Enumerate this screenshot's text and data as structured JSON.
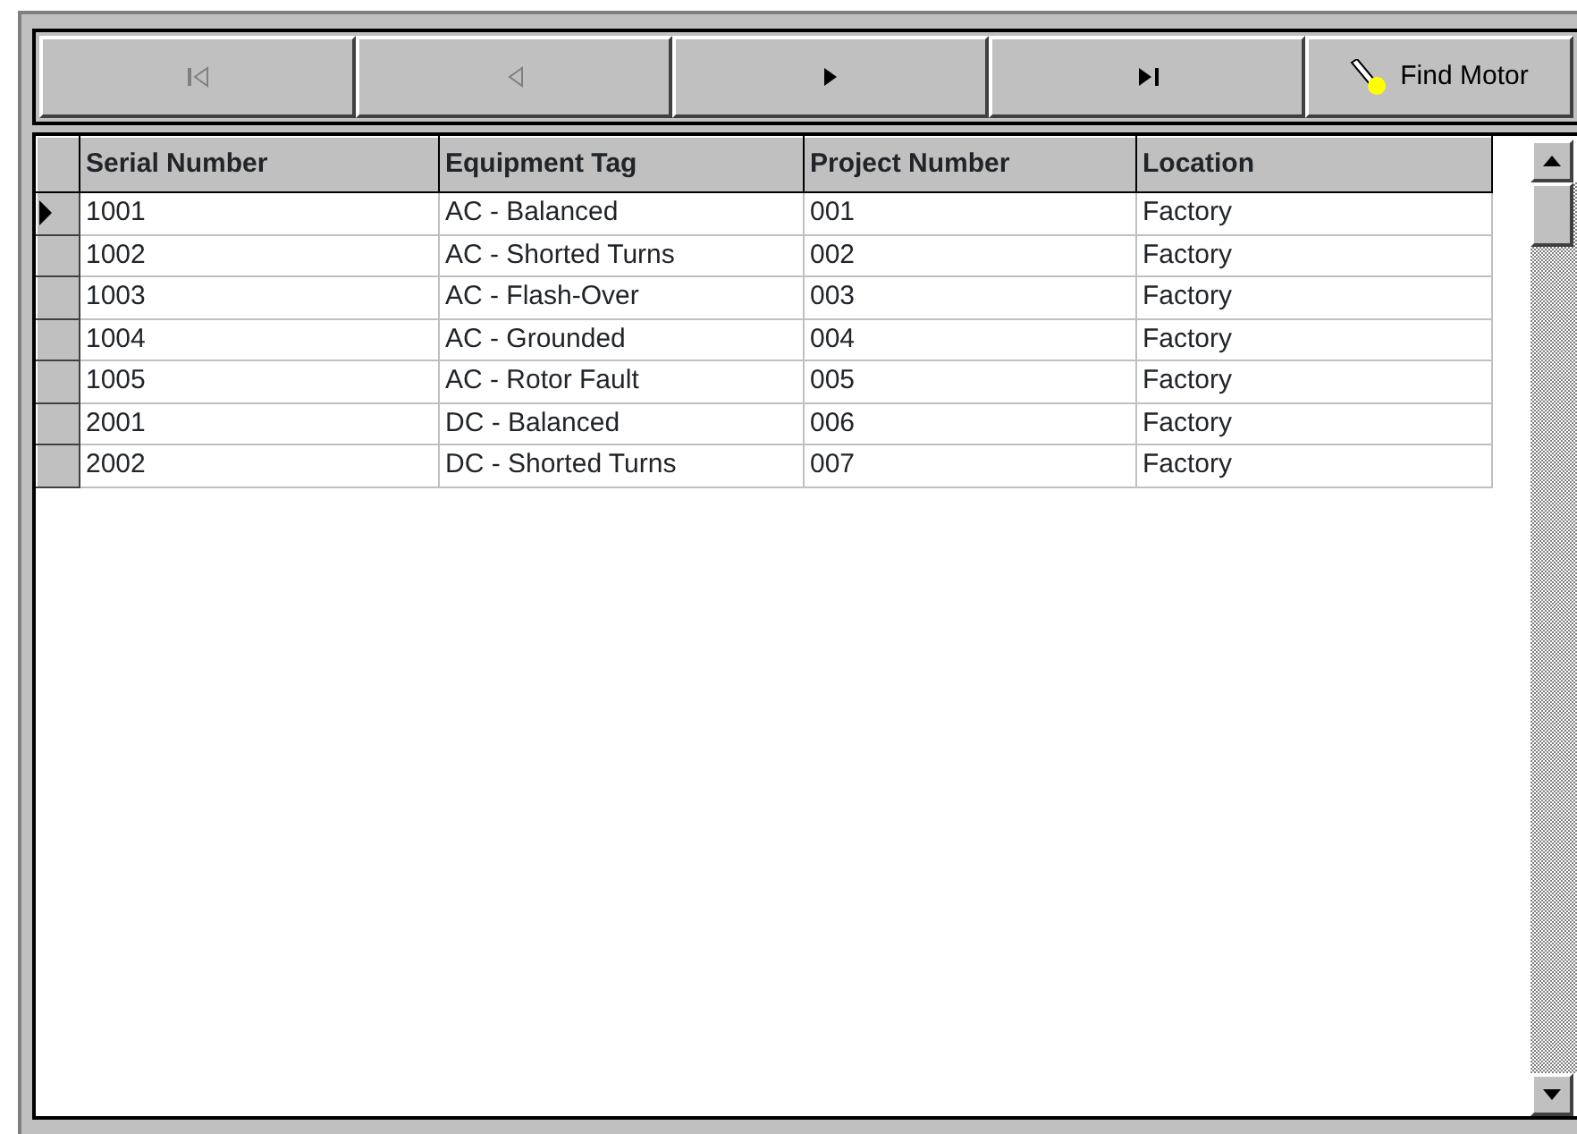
{
  "navigator": {
    "buttons": [
      {
        "kind": "first",
        "disabled": true
      },
      {
        "kind": "prev",
        "disabled": true
      },
      {
        "kind": "next",
        "disabled": false
      },
      {
        "kind": "last",
        "disabled": false
      },
      {
        "kind": "find",
        "label": "Find Motor"
      }
    ]
  },
  "table": {
    "columns": [
      "Serial Number",
      "Equipment Tag",
      "Project Number",
      "Location"
    ],
    "rows": [
      {
        "selected": true,
        "cells": [
          "1001",
          "AC - Balanced",
          "001",
          "Factory"
        ]
      },
      {
        "selected": false,
        "cells": [
          "1002",
          "AC - Shorted Turns",
          "002",
          "Factory"
        ]
      },
      {
        "selected": false,
        "cells": [
          "1003",
          "AC - Flash-Over",
          "003",
          "Factory"
        ]
      },
      {
        "selected": false,
        "cells": [
          "1004",
          "AC - Grounded",
          "004",
          "Factory"
        ]
      },
      {
        "selected": false,
        "cells": [
          "1005",
          "AC - Rotor Fault",
          "005",
          "Factory"
        ]
      },
      {
        "selected": false,
        "cells": [
          "2001",
          "DC - Balanced",
          "006",
          "Factory"
        ]
      },
      {
        "selected": false,
        "cells": [
          "2002",
          "DC - Shorted Turns",
          "007",
          "Factory"
        ]
      }
    ]
  }
}
